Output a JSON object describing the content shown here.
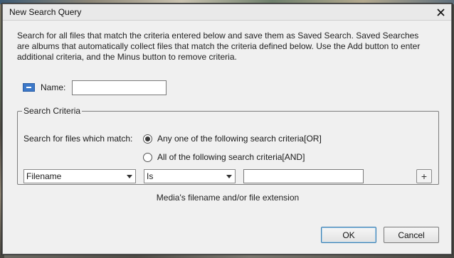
{
  "dialog": {
    "title": "New Search Query",
    "intro": "Search for all files that match the criteria entered below and save them as Saved Search. Saved Searches are albums that automatically collect files that match the criteria defined below. Use the Add button to enter additional criteria, and the Minus button to remove criteria.",
    "name_label": "Name:",
    "name_value": ""
  },
  "criteria": {
    "legend": "Search Criteria",
    "match_label": "Search for files which match:",
    "options": [
      {
        "label": "Any one of the following search criteria[OR]",
        "checked": true
      },
      {
        "label": "All of the following search criteria[AND]",
        "checked": false
      }
    ],
    "field_select": "Filename",
    "operator_select": "Is",
    "value": "",
    "add_label": "+"
  },
  "hint": "Media's filename and/or file extension",
  "buttons": {
    "ok": "OK",
    "cancel": "Cancel"
  },
  "icons": [
    "close-icon",
    "name-tag-icon",
    "chevron-down-icon",
    "plus-icon"
  ]
}
